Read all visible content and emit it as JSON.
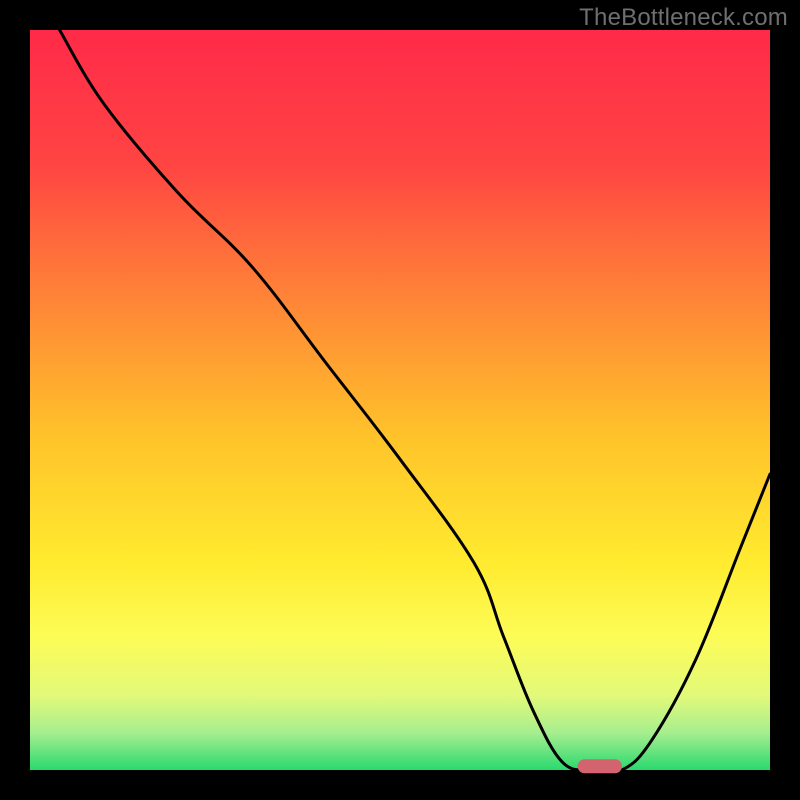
{
  "watermark": "TheBottleneck.com",
  "chart_data": {
    "type": "line",
    "title": "",
    "xlabel": "",
    "ylabel": "",
    "xlim": [
      0,
      100
    ],
    "ylim": [
      0,
      100
    ],
    "x": [
      4,
      10,
      20,
      30,
      40,
      50,
      60,
      64,
      68,
      72,
      76,
      80,
      84,
      90,
      96,
      100
    ],
    "y": [
      100,
      90,
      78,
      68,
      55,
      42,
      28,
      18,
      8,
      1,
      0,
      0,
      4,
      15,
      30,
      40
    ],
    "marker": {
      "x": 77,
      "y": 0.5,
      "width": 6,
      "color": "#d3636e"
    },
    "gradient_stops": [
      {
        "offset": 0.0,
        "color": "#ff2a49"
      },
      {
        "offset": 0.18,
        "color": "#ff4443"
      },
      {
        "offset": 0.38,
        "color": "#ff8a36"
      },
      {
        "offset": 0.55,
        "color": "#ffc32a"
      },
      {
        "offset": 0.72,
        "color": "#ffeb2f"
      },
      {
        "offset": 0.82,
        "color": "#fdfc57"
      },
      {
        "offset": 0.9,
        "color": "#e2f97a"
      },
      {
        "offset": 0.95,
        "color": "#a6ee8e"
      },
      {
        "offset": 1.0,
        "color": "#2ad96f"
      }
    ],
    "plot_border_px": 30
  }
}
